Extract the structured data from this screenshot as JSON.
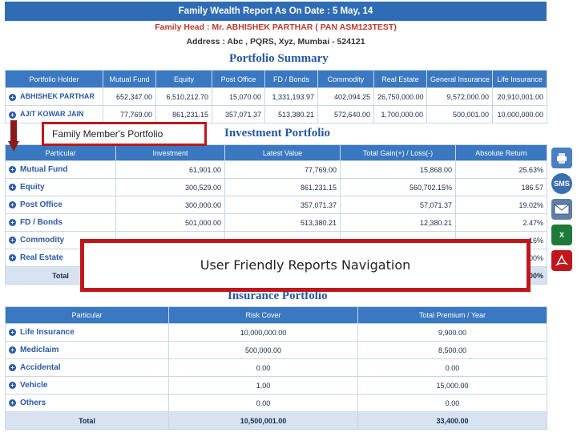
{
  "header": {
    "report_title": "Family Wealth Report As On Date : 5 May, 14",
    "family_head": "Family Head : Mr. ABHISHEK PARTHAR ( PAN ASM123TEST)",
    "address": "Address : Abc , PQRS, Xyz, Mumbai - 524121"
  },
  "portfolio_summary": {
    "title": "Portfolio Summary",
    "columns": [
      "Portfolio Holder",
      "Mutual Fund",
      "Equity",
      "Post Office",
      "FD / Bonds",
      "Commodity",
      "Real Estate",
      "General Insurance",
      "Life Insurance"
    ],
    "rows": [
      [
        "ABHISHEK PARTHAR",
        "652,347.00",
        "6,510,212.70",
        "15,070.00",
        "1,331,193.97",
        "402,094.25",
        "26,750,000.00",
        "9,572,000.00",
        "20,910,001.00"
      ],
      [
        "AJIT KOWAR JAIN",
        "77,769.00",
        "861,231.15",
        "357,071.37",
        "513,380.21",
        "572,640.00",
        "1,700,000.00",
        "500,001.00",
        "10,000,000.00"
      ]
    ]
  },
  "annotation_family": "Family Member's Portfolio",
  "annotation_reports": "User Friendly Reports Navigation",
  "investment_portfolio": {
    "title": "Investment Portfolio",
    "columns": [
      "Particular",
      "Investment",
      "Latest Value",
      "Total Gain(+) / Loss(-)",
      "Absolute Return"
    ],
    "rows": [
      [
        "Mutual Fund",
        "61,901.00",
        "77,769.00",
        "15,868.00",
        "25.63%"
      ],
      [
        "Equity",
        "300,529.00",
        "861,231.15",
        "560,702.15%",
        "186.57"
      ],
      [
        "Post Office",
        "300,000.00",
        "357,071.37",
        "57,071.37",
        "19.02%"
      ],
      [
        "FD / Bonds",
        "501,000.00",
        "513,380.21",
        "12,380.21",
        "2.47%"
      ],
      [
        "Commodity",
        "",
        "",
        "",
        "16%"
      ],
      [
        "Real Estate",
        "",
        "",
        "",
        "00%"
      ]
    ],
    "total_label": "Total",
    "total_return": "00%"
  },
  "insurance_portfolio": {
    "title": "Insurance Portfolio",
    "columns": [
      "Particular",
      "Risk Cover",
      "Total Premium / Year"
    ],
    "rows": [
      [
        "Life Insurance",
        "10,000,000.00",
        "9,900.00"
      ],
      [
        "Mediclaim",
        "500,000.00",
        "8,500.00"
      ],
      [
        "Accidental",
        "0.00",
        "0.00"
      ],
      [
        "Vehicle",
        "1.00",
        "15,000.00"
      ],
      [
        "Others",
        "0.00",
        "0.00"
      ]
    ],
    "total": [
      "Total",
      "10,500,001.00",
      "33,400.00"
    ]
  },
  "side_icons": [
    {
      "name": "print-icon",
      "label": "",
      "color": "#4a7fc1"
    },
    {
      "name": "sms-icon",
      "label": "SMS",
      "color": "#3a6fb0"
    },
    {
      "name": "email-icon",
      "label": "",
      "color": "#5d7fa8"
    },
    {
      "name": "excel-icon",
      "label": "X",
      "color": "#1f7a3a"
    },
    {
      "name": "pdf-icon",
      "label": "",
      "color": "#c0171c"
    }
  ]
}
